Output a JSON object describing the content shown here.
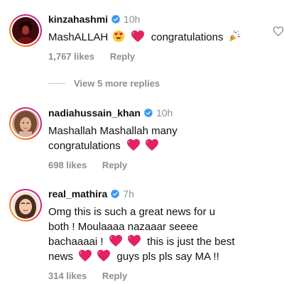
{
  "comments": [
    {
      "username": "kinzahashmi",
      "time": "10h",
      "text_parts": [
        "MashALLAH",
        "congratulations"
      ],
      "likes": "1,767 likes",
      "reply": "Reply"
    },
    {
      "username": "nadiahussain_khan",
      "time": "10h",
      "line1": "Mashallah Mashallah many",
      "line2": "congratulations",
      "likes": "698 likes",
      "reply": "Reply"
    },
    {
      "username": "real_mathira",
      "time": "7h",
      "line1": "Omg this is such a great news for u",
      "line2": "both ! Moulaaaa nazaaar seeee",
      "line3a": "bachaaaai !",
      "line3b": "this is just the best",
      "line4a": "news",
      "line4b": "guys pls pls say MA !!",
      "likes": "314 likes",
      "reply": "Reply"
    }
  ],
  "view_replies": "View 5 more replies",
  "colors": {
    "heart": "#e0245e",
    "verified": "#3897f0",
    "muted": "#8e8e8e"
  },
  "icons": [
    "verified-badge-icon",
    "red-heart-icon",
    "heart-eyes-emoji-icon",
    "party-popper-icon",
    "like-heart-outline-icon"
  ]
}
